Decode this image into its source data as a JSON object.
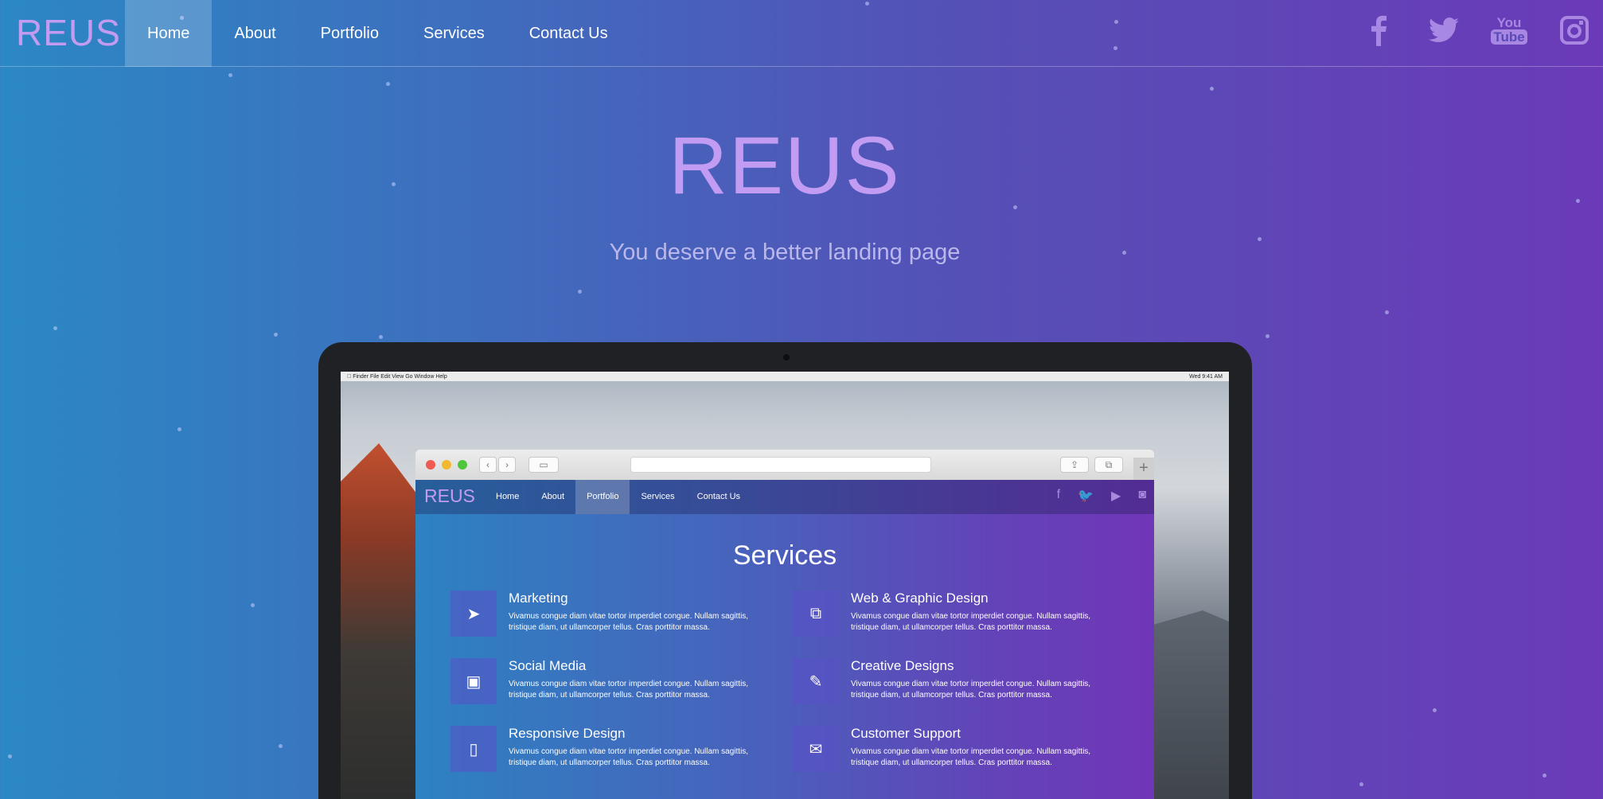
{
  "nav": {
    "brand": "REUS",
    "items": [
      {
        "label": "Home",
        "active": true
      },
      {
        "label": "About",
        "active": false
      },
      {
        "label": "Portfolio",
        "active": false
      },
      {
        "label": "Services",
        "active": false
      },
      {
        "label": "Contact Us",
        "active": false
      }
    ],
    "social_icons": [
      "facebook-icon",
      "twitter-icon",
      "youtube-icon",
      "instagram-icon"
    ],
    "youtube_text": {
      "top": "You",
      "bottom": "Tube"
    }
  },
  "hero": {
    "title": "REUS",
    "subtitle": "You deserve a better landing page"
  },
  "mockup": {
    "menubar": {
      "left": "  Finder  File  Edit  View  Go  Window  Help",
      "right": "Wed 9:41 AM"
    },
    "site": {
      "brand": "REUS",
      "nav_items": [
        {
          "label": "Home",
          "active": false
        },
        {
          "label": "About",
          "active": false
        },
        {
          "label": "Portfolio",
          "active": true
        },
        {
          "label": "Services",
          "active": false
        },
        {
          "label": "Contact Us",
          "active": false
        }
      ],
      "section_title": "Services",
      "services": [
        {
          "title": "Marketing",
          "desc": "Vivamus congue diam vitae tortor imperdiet congue. Nullam sagittis, tristique diam, ut ullamcorper tellus. Cras porttitor massa.",
          "icon": "paper-plane-icon"
        },
        {
          "title": "Web & Graphic Design",
          "desc": "Vivamus congue diam vitae tortor imperdiet congue. Nullam sagittis, tristique diam, ut ullamcorper tellus. Cras porttitor massa.",
          "icon": "copy-icon"
        },
        {
          "title": "Social Media",
          "desc": "Vivamus congue diam vitae tortor imperdiet congue. Nullam sagittis, tristique diam, ut ullamcorper tellus. Cras porttitor massa.",
          "icon": "twitter-square-icon"
        },
        {
          "title": "Creative Designs",
          "desc": "Vivamus congue diam vitae tortor imperdiet congue. Nullam sagittis, tristique diam, ut ullamcorper tellus. Cras porttitor massa.",
          "icon": "magic-wand-icon"
        },
        {
          "title": "Responsive Design",
          "desc": "Vivamus congue diam vitae tortor imperdiet congue. Nullam sagittis, tristique diam, ut ullamcorper tellus. Cras porttitor massa.",
          "icon": "mobile-icon"
        },
        {
          "title": "Customer Support",
          "desc": "Vivamus congue diam vitae tortor imperdiet congue. Nullam sagittis, tristique diam, ut ullamcorper tellus. Cras porttitor massa.",
          "icon": "envelope-icon"
        }
      ]
    }
  },
  "colors": {
    "brand": "#c39bf0",
    "bg_left": "#2b88c4",
    "bg_right": "#6b3ab8"
  }
}
